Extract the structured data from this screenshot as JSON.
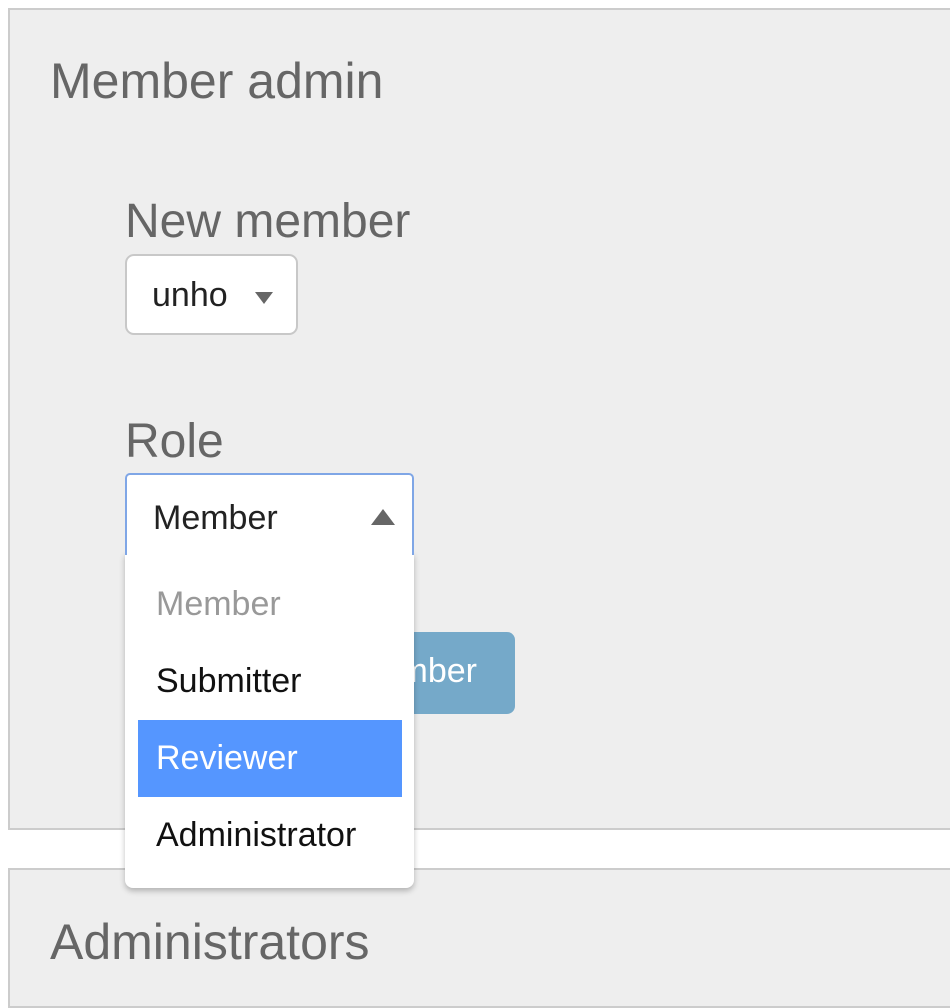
{
  "member_admin": {
    "title": "Member admin",
    "new_member": {
      "label": "New member",
      "selected": "unho"
    },
    "role": {
      "label": "Role",
      "selected": "Member",
      "options": [
        {
          "label": "Member",
          "state": "disabled"
        },
        {
          "label": "Submitter",
          "state": "normal"
        },
        {
          "label": "Reviewer",
          "state": "highlighted"
        },
        {
          "label": "Administrator",
          "state": "normal"
        }
      ]
    },
    "add_button_label": "Add member"
  },
  "administrators": {
    "title": "Administrators"
  },
  "colors": {
    "panel_bg": "#eeeeee",
    "button_bg": "#75a9c9",
    "highlight": "#5596ff",
    "focus_border": "#7fa6e6"
  },
  "icons": {
    "member_select_caret": "caret-down-icon",
    "role_select_caret": "caret-up-icon"
  }
}
